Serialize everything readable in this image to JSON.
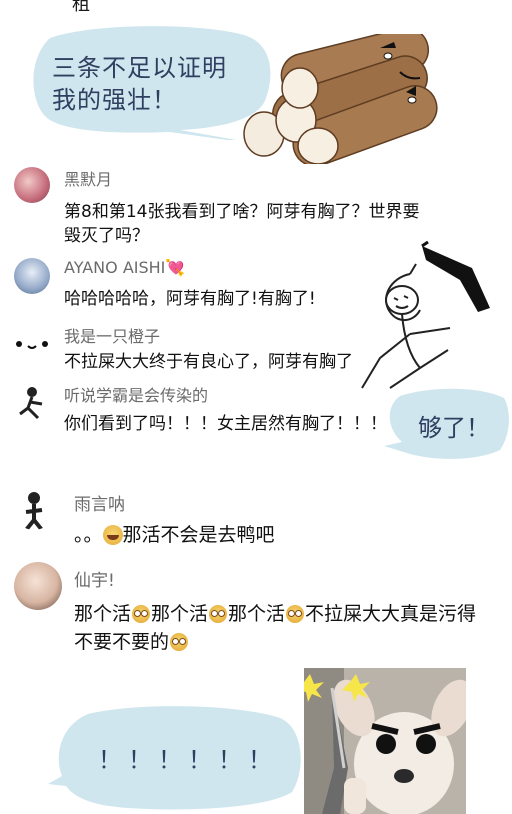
{
  "top_fragment": "租",
  "bubbles": {
    "first_line1": "三条不足以证明",
    "first_line2": "我的强壮！",
    "enough": "够了！",
    "exclaim": "！！！！！！"
  },
  "comments": [
    {
      "username": "黑默月",
      "text": "第8和第14张我看到了啥？阿芽有胸了？世界要毁灭了吗？"
    },
    {
      "username": "AYANO AISHI💘",
      "text": "哈哈哈哈哈，阿芽有胸了!有胸了!"
    },
    {
      "username": "我是一只橙子",
      "text": "不拉屎大大终于有良心了，阿芽有胸了"
    },
    {
      "username": "听说学霸是会传染的",
      "text": "你们看到了吗！！！女主居然有胸了！！！"
    },
    {
      "username": "雨言呐",
      "text_prefix": "。。",
      "text_suffix": "那活不会是去鸭吧"
    },
    {
      "username": "仙宇!",
      "text_parts": [
        "那个活",
        "那个活",
        "那个活",
        "不拉屎大大真是污得不要不要的"
      ]
    }
  ],
  "icons": {
    "yam_sticker": "yam-sticker-image",
    "stick_figure": "stick-figure-knife-image",
    "dog_with_knife": "dog-with-knife-image"
  },
  "colors": {
    "bubble": "#cfe6ee",
    "bubble_text": "#2f3f60",
    "username": "#6b6b6b"
  }
}
